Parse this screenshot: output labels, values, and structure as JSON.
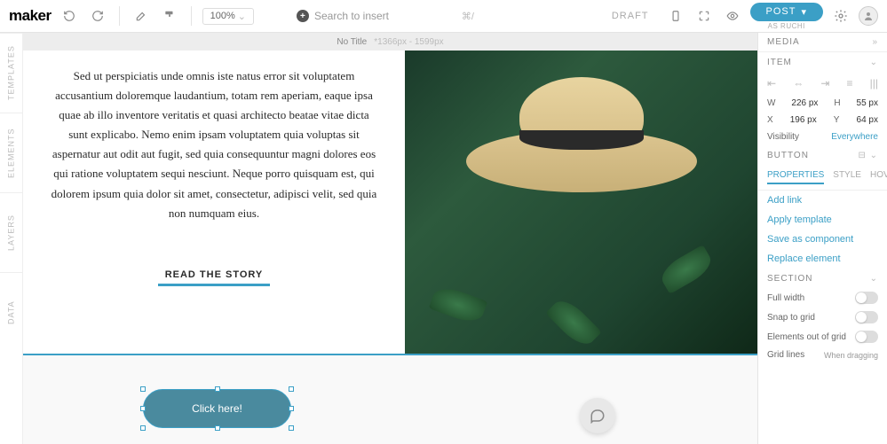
{
  "header": {
    "logo": "maker",
    "zoom": "100%",
    "search_placeholder": "Search to insert",
    "search_shortcut": "⌘/",
    "draft": "DRAFT",
    "post": "POST",
    "as_user": "AS RUCHI"
  },
  "vtabs": [
    "TEMPLATES",
    "ELEMENTS",
    "LAYERS",
    "DATA"
  ],
  "canvas": {
    "title": "No Title",
    "dimensions": "*1366px - 1599px",
    "paragraph": "Sed ut perspiciatis unde omnis iste natus error sit voluptatem accusantium doloremque laudantium, totam rem aperiam, eaque ipsa quae ab illo inventore veritatis et quasi architecto beatae vitae dicta sunt explicabo. Nemo enim ipsam voluptatem quia voluptas sit aspernatur aut odit aut fugit, sed quia consequuntur magni dolores eos qui ratione voluptatem sequi nesciunt. Neque porro quisquam est, qui dolorem ipsum quia dolor sit amet, consectetur, adipisci velit, sed quia non numquam eius.",
    "read_button": "READ THE STORY",
    "click_button": "Click here!"
  },
  "panel": {
    "media": "MEDIA",
    "item": "ITEM",
    "w_label": "W",
    "w_val": "226 px",
    "h_label": "H",
    "h_val": "55 px",
    "x_label": "X",
    "x_val": "196 px",
    "y_label": "Y",
    "y_val": "64 px",
    "visibility": "Visibility",
    "visibility_val": "Everywhere",
    "button": "BUTTON",
    "tabs": {
      "properties": "PROPERTIES",
      "style": "STYLE",
      "hover": "HOVER"
    },
    "links": {
      "add": "Add link",
      "apply": "Apply template",
      "save": "Save as component",
      "replace": "Replace element"
    },
    "section": "SECTION",
    "toggles": {
      "full": "Full width",
      "snap": "Snap to grid",
      "out": "Elements out of grid",
      "grid": "Grid lines"
    },
    "grid_val": "When dragging"
  }
}
